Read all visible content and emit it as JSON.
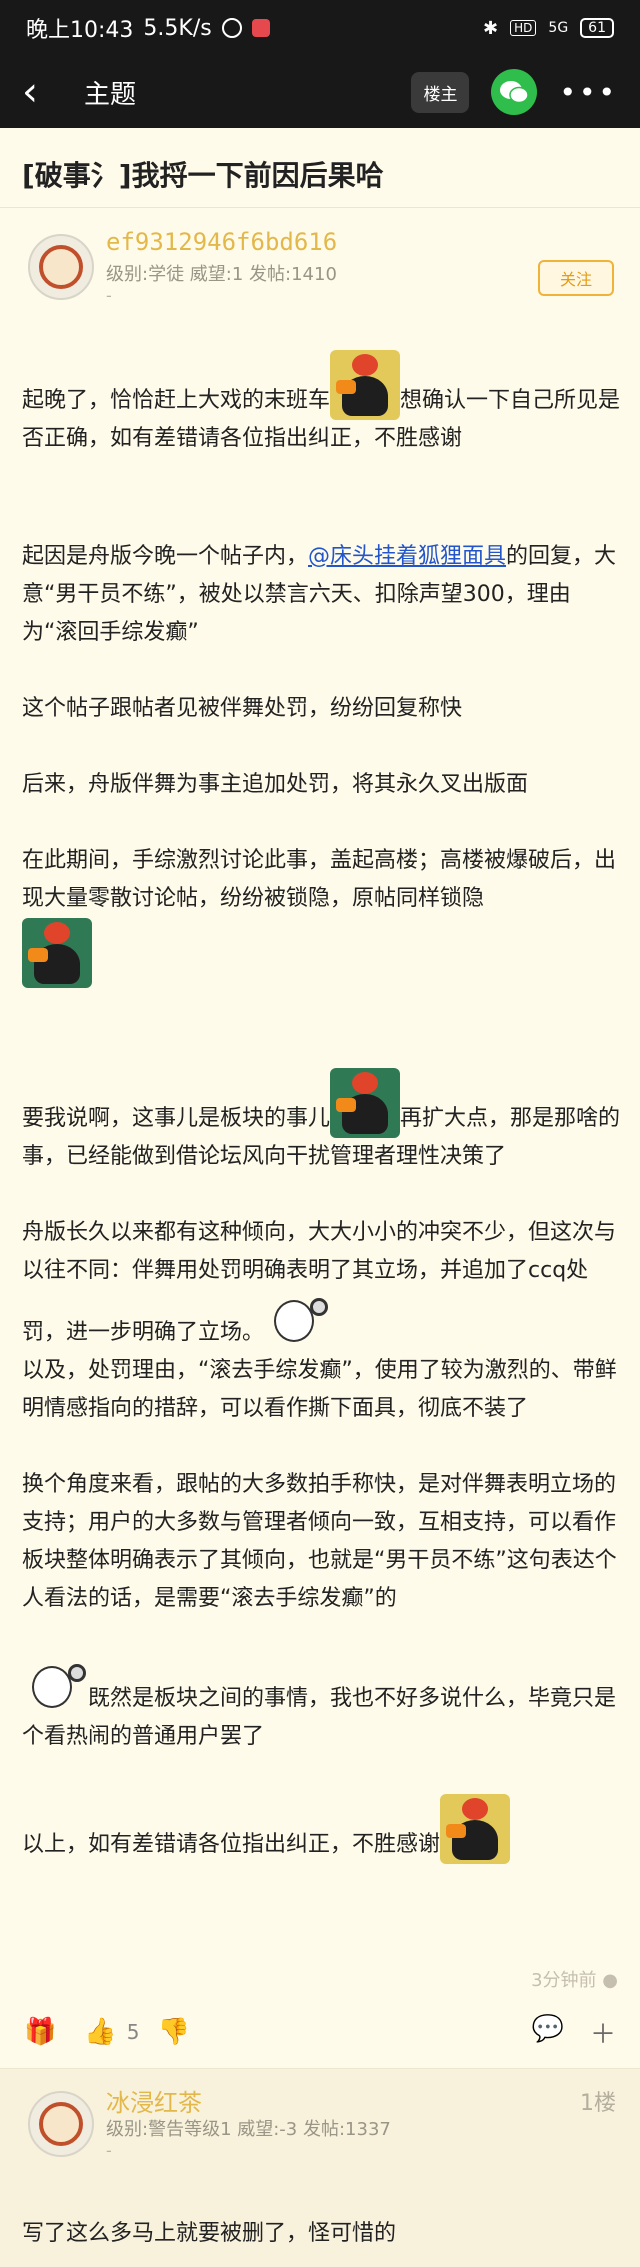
{
  "status": {
    "time": "晚上10:43",
    "speed": "5.5K/s",
    "hd": "HD",
    "signal": "5G",
    "battery": "61"
  },
  "nav": {
    "title": "主题",
    "louzhu": "楼主"
  },
  "topic": {
    "title": "[破事氵]我捋一下前因后果哈"
  },
  "author": {
    "name": "ef9312946f6bd616",
    "meta": "级别:学徒 威望:1 发帖:1410",
    "dash": "-",
    "follow": "关注"
  },
  "post": {
    "p1a": "起晚了，恰恰赶上大戏的末班车",
    "p1b": "想确认一下自己所见是否正确，如有差错请各位指出纠正，不胜感谢",
    "p2a": "起因是舟版今晚一个帖子内，",
    "p2link": "@床头挂着狐狸面具",
    "p2b": "的回复，大意“男干员不练”，被处以禁言六天、扣除声望300，理由为“滚回手综发癫”",
    "p3": "这个帖子跟帖者见被伴舞处罚，纷纷回复称快",
    "p4": "后来，舟版伴舞为事主追加处罚，将其永久叉出版面",
    "p5": "在此期间，手综激烈讨论此事，盖起高楼；高楼被爆破后，出现大量零散讨论帖，纷纷被锁隐，原帖同样锁隐",
    "p6a": "要我说啊，这事儿是板块的事儿",
    "p6b": "再扩大点，那是那啥的事，已经能做到借论坛风向干扰管理者理性决策了",
    "p7": "舟版长久以来都有这种倾向，大大小小的冲突不少，但这次与以往不同：伴舞用处罚明确表明了其立场，并追加了ccq处罚，进一步明确了立场。",
    "p8": "以及，处罚理由，“滚去手综发癫”，使用了较为激烈的、带鲜明情感指向的措辞，可以看作撕下面具，彻底不装了",
    "p9": "换个角度来看，跟帖的大多数拍手称快，是对伴舞表明立场的支持；用户的大多数与管理者倾向一致，互相支持，可以看作板块整体明确表示了其倾向，也就是“男干员不练”这句表达个人看法的话，是需要“滚去手综发癫”的",
    "p10": "既然是板块之间的事情，我也不好多说什么，毕竟只是个看热闹的普通用户罢了",
    "p11": "以上，如有差错请各位指出纠正，不胜感谢",
    "time": "3分钟前",
    "likes": "5"
  },
  "reply": {
    "name": "冰浸红茶",
    "floor": "1楼",
    "meta": "级别:警告等级1 威望:-3 发帖:1337",
    "dash": "-",
    "text": "写了这么多马上就要被删了，怪可惜的"
  },
  "colors": {
    "bar": "#181818",
    "background": "#fffbea",
    "username": "#e3b84b",
    "follow": "#f0b33a",
    "link": "#2255cc",
    "wechat": "#2fbd4b"
  }
}
